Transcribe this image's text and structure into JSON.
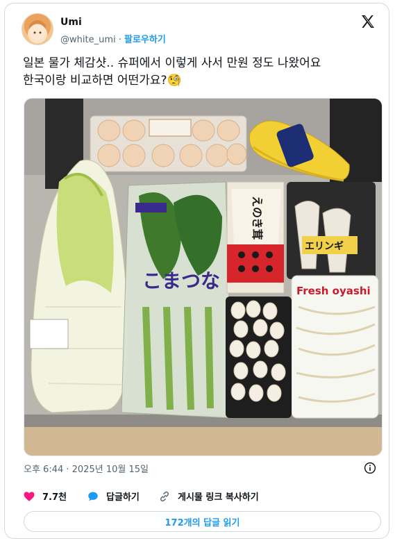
{
  "author": {
    "name": "Umi",
    "handle": "@white_umi",
    "separator": "·",
    "follow_label": "팔로우하기"
  },
  "tweet": {
    "text_line1": "일본 물가 체감샷.. 슈퍼에서 이렇게 사서 만원 정도 나왔어요",
    "text_line2": "한국이랑 비교하면 어떤가요?🧐",
    "timestamp": "오후 6:44 · 2025년 10월 15일"
  },
  "photo": {
    "komatsuna_label": "こまつな",
    "enoki_label": "えのき茸",
    "eringi_label": "エリンギ",
    "moyashi_label": "Fresh oyashi"
  },
  "actions": {
    "likes": "7.7천",
    "reply_label": "답글하기",
    "copy_link_label": "게시물 링크 복사하기"
  },
  "replies_button": "172개의 답글 읽기",
  "colors": {
    "accent": "#1d9bf0",
    "like": "#f91880",
    "muted": "#536471"
  }
}
